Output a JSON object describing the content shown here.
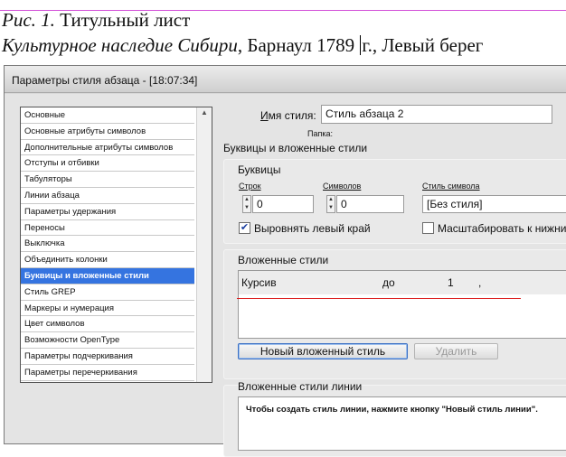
{
  "document": {
    "caption_italic": "Рис. 1.",
    "caption_rest": " Титульный лист",
    "line2_italic": "Культурное наследие Сибири",
    "line2_before_caret": ", Барнаул 1789 ",
    "line2_after_caret": "г., Левый берег"
  },
  "dialog": {
    "title": "Параметры стиля абзаца - [18:07:34]",
    "categories": [
      "Основные",
      "Основные атрибуты символов",
      "Дополнительные атрибуты символов",
      "Отступы и отбивки",
      "Табуляторы",
      "Линии абзаца",
      "Параметры удержания",
      "Переносы",
      "Выключка",
      "Объединить колонки",
      "Буквицы и вложенные стили",
      "Стиль GREP",
      "Маркеры и нумерация",
      "Цвет символов",
      "Возможности OpenType",
      "Параметры подчеркивания",
      "Параметры перечеркивания"
    ],
    "selected_index": 10,
    "style_name_label_underlined": "И",
    "style_name_label_rest": "мя стиля:",
    "style_name_value": "Стиль абзаца 2",
    "folder_label": "Папка:",
    "section_title": "Буквицы и вложенные стили",
    "dropcaps": {
      "title": "Буквицы",
      "lines_label": "Строк",
      "lines_value": "0",
      "chars_label": "Символов",
      "chars_value": "0",
      "char_style_label": "Стиль символа",
      "char_style_value": "[Без стиля]",
      "align_left_label": "Выровнять левый край",
      "align_left_checked": true,
      "scale_label": "Масштабировать к нижни",
      "scale_checked": false
    },
    "nested_styles": {
      "title": "Вложенные стили",
      "row": {
        "style": "Курсив",
        "through": "до",
        "count": "1",
        "delimiter": ","
      },
      "new_button": "Новый вложенный стиль",
      "delete_button": "Удалить"
    },
    "nested_line_styles": {
      "title": "Вложенные стили линии",
      "hint": "Чтобы создать стиль линии, нажмите кнопку \"Новый стиль линии\"."
    }
  }
}
